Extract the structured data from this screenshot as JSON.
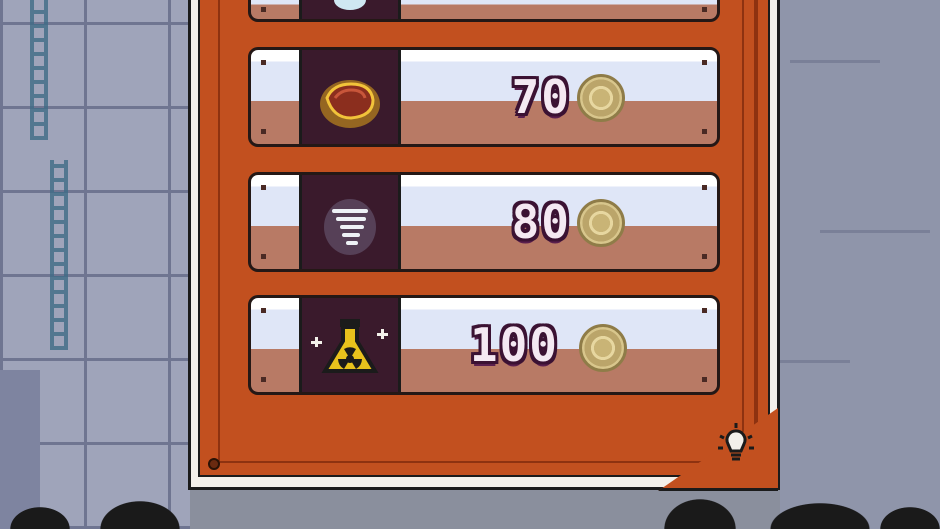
{
  "shop": {
    "items": [
      {
        "name": "partial-item",
        "price": "",
        "icon": "ice-crystal-icon"
      },
      {
        "name": "meat",
        "price": "70",
        "icon": "meat-icon"
      },
      {
        "name": "whirlwind",
        "price": "80",
        "icon": "whirlwind-icon"
      },
      {
        "name": "potion",
        "price": "100",
        "icon": "radioactive-potion-icon"
      }
    ],
    "currency_icon": "coin-icon",
    "hint_icon": "lightbulb-icon"
  },
  "colors": {
    "panel_orange": "#c2501f",
    "price_text": "#f4e9f2",
    "price_outline": "#3b1233",
    "coin_gold": "#d8c68c"
  }
}
